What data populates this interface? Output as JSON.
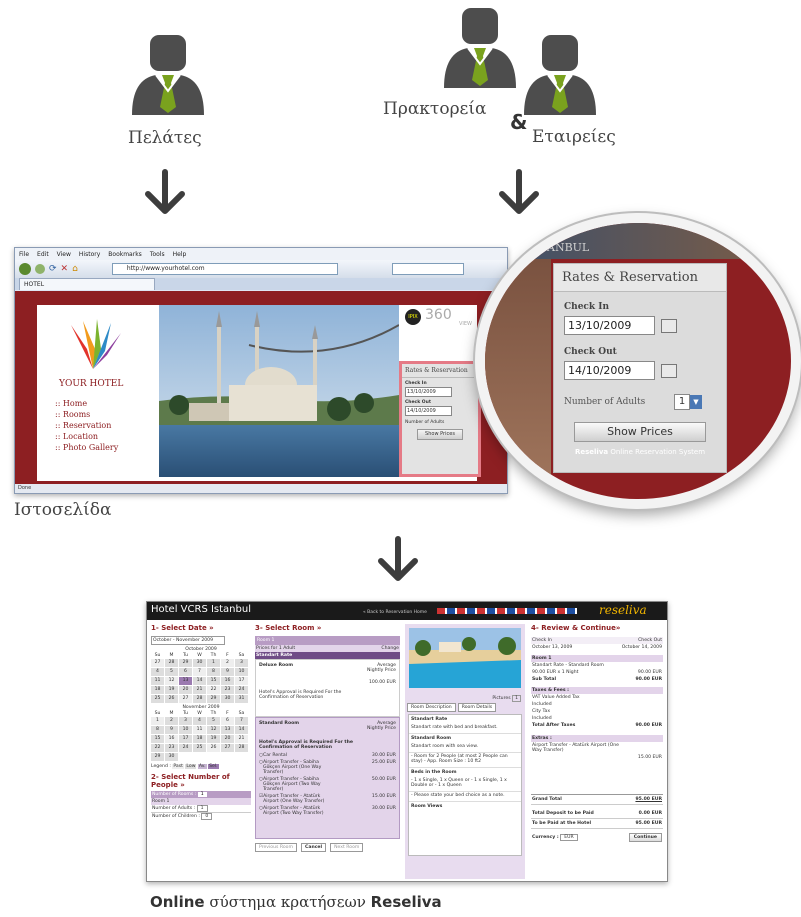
{
  "labels": {
    "customers": "Πελάτες",
    "agencies": "Πρακτορεία",
    "ampersand": "&",
    "companies": "Εταιρείες",
    "website": "Ιστοσελίδα",
    "online_bold": "Online",
    "online_rest": " σύστημα κρατήσεων ",
    "reseliva": "Reseliva"
  },
  "colors": {
    "accent_red": "#8d1f22",
    "person_gray": "#4d4d4d",
    "tie_green": "#7aa21e"
  },
  "browser": {
    "menu": [
      "File",
      "Edit",
      "View",
      "History",
      "Bookmarks",
      "Tools",
      "Help"
    ],
    "url": "http://www.yourhotel.com",
    "tab": "HOTEL",
    "status": "Done",
    "site": {
      "logo": "YOUR HOTEL",
      "nav": [
        ":: Home",
        ":: Rooms",
        ":: Reservation",
        ":: Location",
        ":: Photo Gallery"
      ],
      "view_badge": "360",
      "view_text": "VIEW",
      "panel_title": "Rates & Reservation",
      "check_in_label": "Check In",
      "check_in": "13/10/2009",
      "check_out_label": "Check Out",
      "check_out": "14/10/2009",
      "adults_label": "Number of Adults",
      "adults": "1",
      "show_prices": "Show Prices"
    }
  },
  "magnifier": {
    "header_strip": "ANBUL",
    "panel_title": "Rates & Reservation",
    "check_in_label": "Check In",
    "check_in": "13/10/2009",
    "check_out_label": "Check Out",
    "check_out": "14/10/2009",
    "adults_label": "Number of Adults",
    "adults": "1",
    "show_prices": "Show Prices",
    "footer_bold": "Reseliva",
    "footer_rest": " Online Reservation System"
  },
  "app": {
    "title": "Hotel VCRS Istanbul",
    "back": "« Back to Reservation Home",
    "brand": "reseliva",
    "col1": "1- Select Date »",
    "month": "October - November 2009",
    "oct": "October 2009",
    "nov": "November 2009",
    "weekdays": [
      "Su",
      "M",
      "Tu",
      "W",
      "Th",
      "F",
      "Sa"
    ],
    "oct_days": [
      "27",
      "28",
      "29",
      "30",
      "1",
      "2",
      "3",
      "4",
      "5",
      "6",
      "7",
      "8",
      "9",
      "10",
      "11",
      "12",
      "13",
      "14",
      "15",
      "16",
      "17",
      "18",
      "19",
      "20",
      "21",
      "22",
      "23",
      "24",
      "25",
      "26",
      "27",
      "28",
      "29",
      "30",
      "31"
    ],
    "nov_days": [
      "1",
      "2",
      "3",
      "4",
      "5",
      "6",
      "7",
      "8",
      "9",
      "10",
      "11",
      "12",
      "13",
      "14",
      "15",
      "16",
      "17",
      "18",
      "19",
      "20",
      "21",
      "22",
      "23",
      "24",
      "25",
      "26",
      "27",
      "28",
      "29",
      "30"
    ],
    "legend": "Legend :",
    "legend_items": [
      "Past",
      "Low",
      "Av.",
      "Sel."
    ],
    "select_people": "2- Select Number of People »",
    "num_rooms": "Number of Rooms :",
    "room1": "Room 1",
    "adults": "Number of Adults :",
    "children": "Number of Children :",
    "one": "1",
    "zero": "0",
    "col2": "3- Select Room »",
    "room_sel": "Room 1",
    "prices_for": "Prices for 1 Adult",
    "change": "Change",
    "standart_rate": "Standart Rate",
    "deluxe": "Deluxe Room",
    "avg": "Average Nightly Price",
    "deluxe_price": "100.00 EUR",
    "approval": "Hotel's Approval is Required For the Confirmation of Reservation",
    "standard_room": "Standard Room",
    "approval2": "Hotel's Approval is Required For the Confirmation of Reservation",
    "extras": [
      {
        "name": "Car Rental",
        "price": "30.00 EUR"
      },
      {
        "name": "Airport Transfer - Sabiha Gökçen Airport (One Way Transfer)",
        "price": "25.00 EUR"
      },
      {
        "name": "Airport Transfer - Sabiha Gökçen Airport (Two Way Transfer)",
        "price": "50.00 EUR"
      },
      {
        "name": "Airport Transfer - Atatürk Airport (One Way Transfer)",
        "price": "15.00 EUR"
      },
      {
        "name": "Airport Transfer - Atatürk Airport (Two Way Transfer)",
        "price": "30.00 EUR"
      }
    ],
    "prev_room": "Previous Room",
    "cancel": "Cancel",
    "next_room": "Next Room",
    "pictures": "Pictures",
    "pictures_n": "1",
    "room_desc": "Room Description",
    "room_details": "Room Details",
    "desc": [
      {
        "h": "Standart Rate",
        "t": "Standart rate with bed and breakfast."
      },
      {
        "h": "Standard Room",
        "t": "Standart room with sea view."
      },
      {
        "h": "",
        "t": "- Room for 2 People (at most 2 People can stay) - App. Room Size : 10 ft2"
      },
      {
        "h": "Beds in the Room",
        "t": "- 1 x Single, 1 x Queen  or  - 1 x Single, 1 x Double  or  - 1 x Queen"
      },
      {
        "h": "",
        "t": "- Please state your bed choice as a note."
      },
      {
        "h": "Room Views",
        "t": ""
      }
    ],
    "col4": "4- Review & Continue»",
    "ci_label": "Check In",
    "co_label": "Check Out",
    "ci_date": "October 13, 2009",
    "co_date": "October 14, 2009",
    "r_room": "Room 1",
    "r_rate": "Standart Rate - Standard Room",
    "r_line": "90.00 EUR x 1 Night",
    "r_line_val": "90.00 EUR",
    "subtotal": "Sub Total",
    "subtotal_val": "90.00 EUR",
    "taxes": "Taxes & Fees :",
    "vat": "VAT Value Added Tax",
    "included": "Included",
    "city_tax": "City Tax",
    "total_after": "Total After Taxes",
    "total_after_val": "90.00 EUR",
    "extras_h": "Extras :",
    "extra_sel": "Airport Transfer - Atatürk Airport (One Way Transfer)",
    "extra_sel_val": "15.00 EUR",
    "grand": "Grand Total",
    "grand_val": "95.00 EUR",
    "deposit": "Total Deposit to be Paid",
    "deposit_val": "0.00 EUR",
    "at_hotel": "To be Paid at the Hotel",
    "at_hotel_val": "95.00 EUR",
    "currency": "Currency :",
    "currency_val": "EUR",
    "continue": "Continue"
  }
}
